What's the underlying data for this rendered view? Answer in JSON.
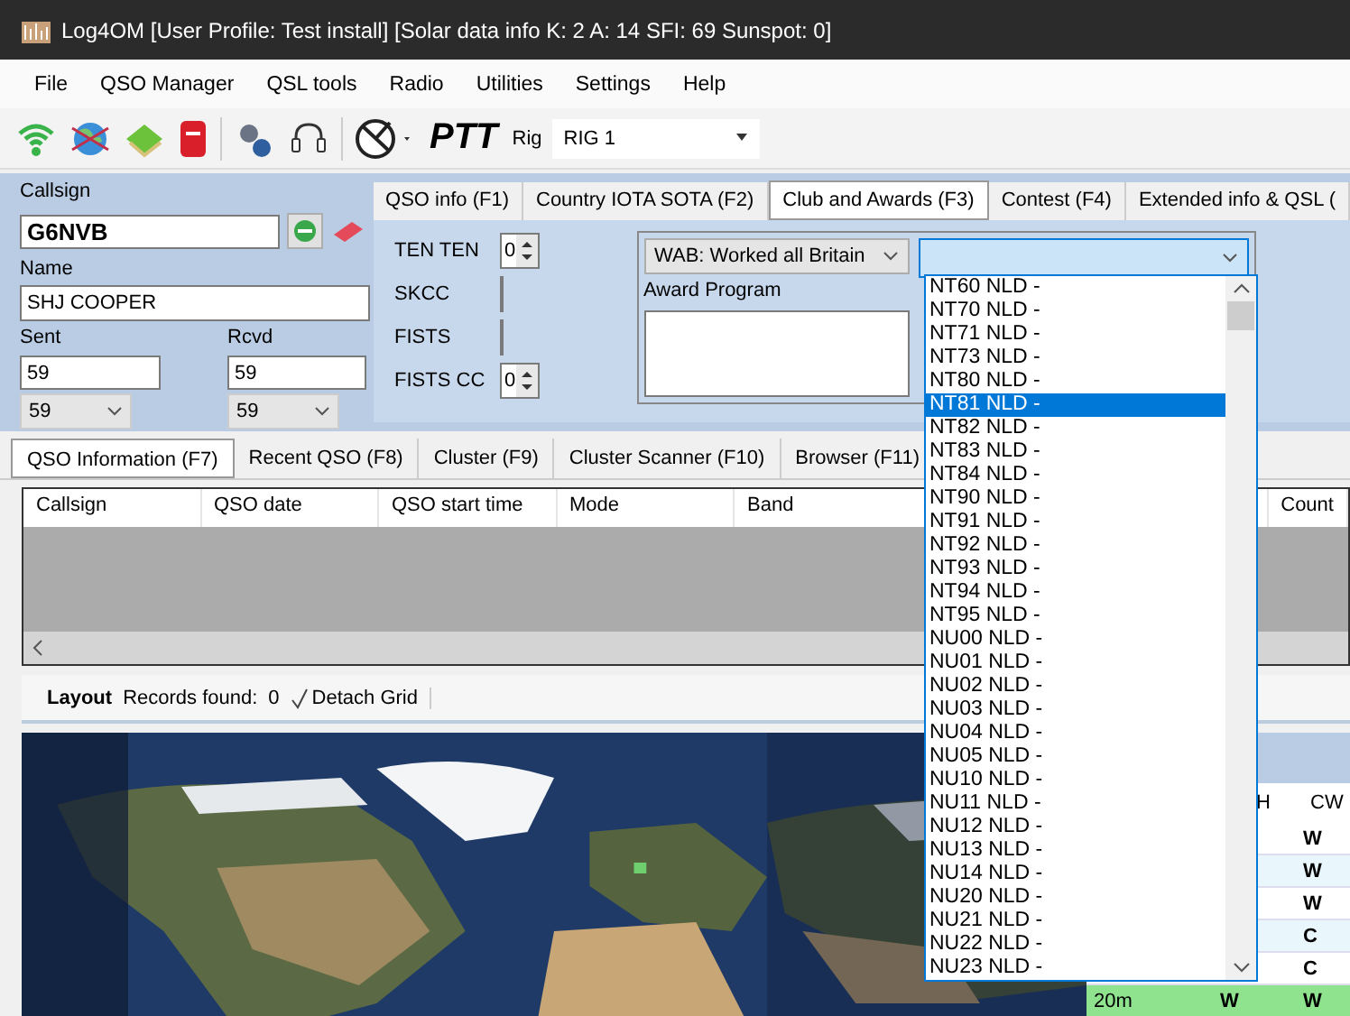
{
  "window": {
    "title": "Log4OM [User Profile: Test install] [Solar data info K: 2 A: 14 SFI: 69 Sunspot: 0]"
  },
  "menu": [
    "File",
    "QSO Manager",
    "QSL tools",
    "Radio",
    "Utilities",
    "Settings",
    "Help"
  ],
  "toolbar": {
    "ptt": "PTT",
    "rig_label": "Rig",
    "rig_value": "RIG 1"
  },
  "qso_entry": {
    "callsign_label": "Callsign",
    "callsign": "G6NVB",
    "name_label": "Name",
    "name": "SHJ COOPER",
    "sent_label": "Sent",
    "sent": "59",
    "sent_option": "59",
    "rcvd_label": "Rcvd",
    "rcvd": "59",
    "rcvd_option": "59"
  },
  "info_tabs": [
    {
      "label": "QSO info (F1)",
      "selected": false
    },
    {
      "label": "Country IOTA SOTA (F2)",
      "selected": false
    },
    {
      "label": "Club and Awards (F3)",
      "selected": true
    },
    {
      "label": "Contest (F4)",
      "selected": false
    },
    {
      "label": "Extended info & QSL (",
      "selected": false
    }
  ],
  "club_awards": {
    "fields": [
      {
        "label": "TEN TEN",
        "kind": "spinner",
        "value": "0"
      },
      {
        "label": "SKCC",
        "kind": "text"
      },
      {
        "label": "FISTS",
        "kind": "text"
      },
      {
        "label": "FISTS CC",
        "kind": "spinner",
        "value": "0"
      }
    ],
    "award": "WAB: Worked all Britain",
    "award_program_label": "Award Program",
    "reference_items": [
      {
        "label": "NT60 NLD -",
        "selected": false
      },
      {
        "label": "NT70 NLD -",
        "selected": false
      },
      {
        "label": "NT71 NLD -",
        "selected": false
      },
      {
        "label": "NT73 NLD -",
        "selected": false
      },
      {
        "label": "NT80 NLD -",
        "selected": false
      },
      {
        "label": "NT81 NLD -",
        "selected": true
      },
      {
        "label": "NT82 NLD -",
        "selected": false
      },
      {
        "label": "NT83 NLD -",
        "selected": false
      },
      {
        "label": "NT84 NLD -",
        "selected": false
      },
      {
        "label": "NT90 NLD -",
        "selected": false
      },
      {
        "label": "NT91 NLD -",
        "selected": false
      },
      {
        "label": "NT92 NLD -",
        "selected": false
      },
      {
        "label": "NT93 NLD -",
        "selected": false
      },
      {
        "label": "NT94 NLD -",
        "selected": false
      },
      {
        "label": "NT95 NLD -",
        "selected": false
      },
      {
        "label": "NU00 NLD -",
        "selected": false
      },
      {
        "label": "NU01 NLD -",
        "selected": false
      },
      {
        "label": "NU02 NLD -",
        "selected": false
      },
      {
        "label": "NU03 NLD -",
        "selected": false
      },
      {
        "label": "NU04 NLD -",
        "selected": false
      },
      {
        "label": "NU05 NLD -",
        "selected": false
      },
      {
        "label": "NU10 NLD -",
        "selected": false
      },
      {
        "label": "NU11 NLD -",
        "selected": false
      },
      {
        "label": "NU12 NLD -",
        "selected": false
      },
      {
        "label": "NU13 NLD -",
        "selected": false
      },
      {
        "label": "NU14 NLD -",
        "selected": false
      },
      {
        "label": "NU20 NLD -",
        "selected": false
      },
      {
        "label": "NU21 NLD -",
        "selected": false
      },
      {
        "label": "NU22 NLD -",
        "selected": false
      },
      {
        "label": "NU23 NLD -",
        "selected": false
      }
    ]
  },
  "bottom_tabs": [
    {
      "label": "QSO Information (F7)",
      "selected": true
    },
    {
      "label": "Recent QSO (F8)",
      "selected": false
    },
    {
      "label": "Cluster (F9)",
      "selected": false
    },
    {
      "label": "Cluster Scanner (F10)",
      "selected": false
    },
    {
      "label": "Browser (F11)",
      "selected": false
    }
  ],
  "grid": {
    "columns": [
      "Callsign",
      "QSO date",
      "QSO start time",
      "Mode",
      "Band",
      "Count"
    ]
  },
  "grid_toolbar": {
    "layout": "Layout",
    "records_label": "Records found:",
    "records": "0",
    "detach": "Detach Grid"
  },
  "band_table": {
    "columns": [
      "H",
      "CW"
    ],
    "rows": [
      {
        "cw": "W",
        "highlighted": false
      },
      {
        "cw": "W",
        "highlighted": false
      },
      {
        "cw": "W",
        "highlighted": false
      },
      {
        "cw": "C",
        "highlighted": false
      },
      {
        "cw": "C",
        "highlighted": false
      },
      {
        "band": "20m",
        "ph": "W",
        "cw": "W",
        "highlighted": true
      }
    ]
  }
}
